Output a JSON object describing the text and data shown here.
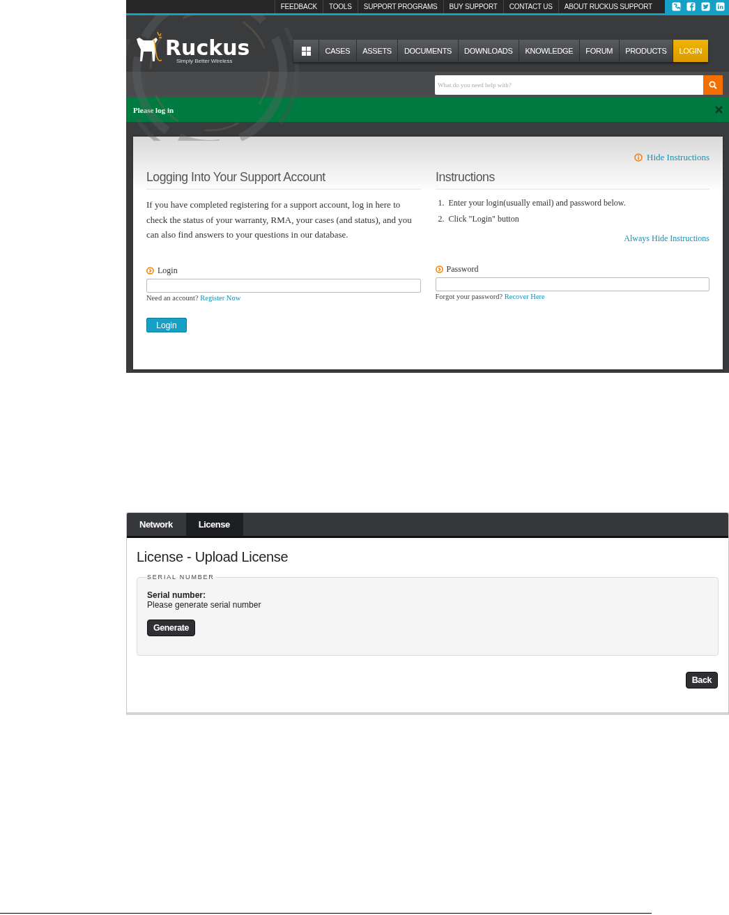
{
  "support_portal": {
    "top_links": [
      "FEEDBACK",
      "TOOLS",
      "SUPPORT PROGRAMS",
      "BUY SUPPORT",
      "CONTACT US",
      "ABOUT RUCKUS SUPPORT"
    ],
    "logo": {
      "name": "Ruckus",
      "tagline": "Simply Better Wireless"
    },
    "nav": [
      {
        "label": "CASES",
        "selected": false
      },
      {
        "label": "ASSETS",
        "selected": false
      },
      {
        "label": "DOCUMENTS",
        "selected": false
      },
      {
        "label": "DOWNLOADS",
        "selected": false
      },
      {
        "label": "KNOWLEDGE",
        "selected": false
      },
      {
        "label": "FORUM",
        "selected": false
      },
      {
        "label": "PRODUCTS",
        "selected": false
      },
      {
        "label": "LOGIN",
        "selected": true
      }
    ],
    "search": {
      "placeholder": "What do you need help with?"
    },
    "alert": "Please log in",
    "hide_instructions": "Hide Instructions",
    "login_section": {
      "title": "Logging Into Your Support Account",
      "intro": "If you have completed registering for a support account, log in here to check the status of your warranty, RMA, your cases (and status), and you can also find answers to your questions in our database."
    },
    "instructions": {
      "title": "Instructions",
      "steps": [
        {
          "number": "1.",
          "text": "Enter your login(usually email) and password below."
        },
        {
          "number": "2.",
          "text": "Click \"Login\" button"
        }
      ],
      "always_hide": "Always Hide Instructions"
    },
    "fields": [
      {
        "label": "Login",
        "hint": "Need an account?",
        "link": "Register Now"
      },
      {
        "label": "Password",
        "hint": "Forgot your password?",
        "link": "Recover Here"
      }
    ],
    "login_button": "Login"
  },
  "license_screen": {
    "tabs": [
      {
        "label": "Network",
        "selected": false
      },
      {
        "label": "License",
        "selected": true
      }
    ],
    "title": "License - Upload License",
    "fieldset": {
      "legend": "SERIAL NUMBER",
      "label": "Serial number:",
      "value": "Please generate serial number",
      "button": "Generate"
    },
    "back_button": "Back"
  }
}
